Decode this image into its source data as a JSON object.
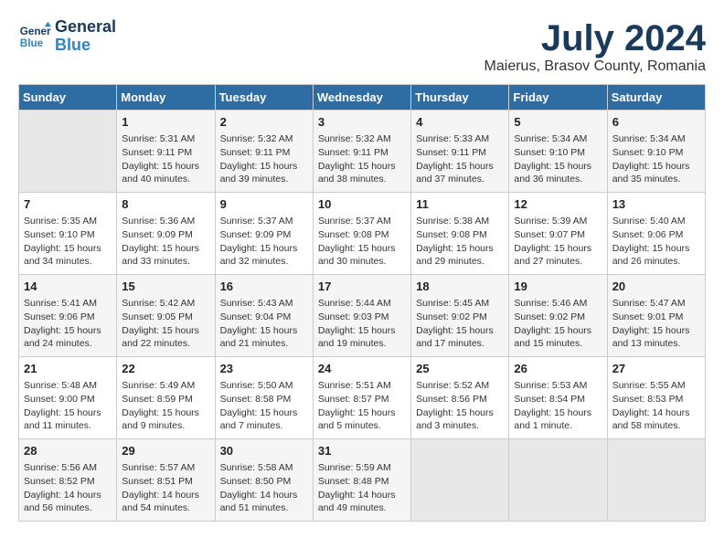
{
  "header": {
    "logo_line1": "General",
    "logo_line2": "Blue",
    "month": "July 2024",
    "location": "Maierus, Brasov County, Romania"
  },
  "days_of_week": [
    "Sunday",
    "Monday",
    "Tuesday",
    "Wednesday",
    "Thursday",
    "Friday",
    "Saturday"
  ],
  "weeks": [
    [
      {
        "day": "",
        "content": ""
      },
      {
        "day": "1",
        "content": "Sunrise: 5:31 AM\nSunset: 9:11 PM\nDaylight: 15 hours\nand 40 minutes."
      },
      {
        "day": "2",
        "content": "Sunrise: 5:32 AM\nSunset: 9:11 PM\nDaylight: 15 hours\nand 39 minutes."
      },
      {
        "day": "3",
        "content": "Sunrise: 5:32 AM\nSunset: 9:11 PM\nDaylight: 15 hours\nand 38 minutes."
      },
      {
        "day": "4",
        "content": "Sunrise: 5:33 AM\nSunset: 9:11 PM\nDaylight: 15 hours\nand 37 minutes."
      },
      {
        "day": "5",
        "content": "Sunrise: 5:34 AM\nSunset: 9:10 PM\nDaylight: 15 hours\nand 36 minutes."
      },
      {
        "day": "6",
        "content": "Sunrise: 5:34 AM\nSunset: 9:10 PM\nDaylight: 15 hours\nand 35 minutes."
      }
    ],
    [
      {
        "day": "7",
        "content": "Sunrise: 5:35 AM\nSunset: 9:10 PM\nDaylight: 15 hours\nand 34 minutes."
      },
      {
        "day": "8",
        "content": "Sunrise: 5:36 AM\nSunset: 9:09 PM\nDaylight: 15 hours\nand 33 minutes."
      },
      {
        "day": "9",
        "content": "Sunrise: 5:37 AM\nSunset: 9:09 PM\nDaylight: 15 hours\nand 32 minutes."
      },
      {
        "day": "10",
        "content": "Sunrise: 5:37 AM\nSunset: 9:08 PM\nDaylight: 15 hours\nand 30 minutes."
      },
      {
        "day": "11",
        "content": "Sunrise: 5:38 AM\nSunset: 9:08 PM\nDaylight: 15 hours\nand 29 minutes."
      },
      {
        "day": "12",
        "content": "Sunrise: 5:39 AM\nSunset: 9:07 PM\nDaylight: 15 hours\nand 27 minutes."
      },
      {
        "day": "13",
        "content": "Sunrise: 5:40 AM\nSunset: 9:06 PM\nDaylight: 15 hours\nand 26 minutes."
      }
    ],
    [
      {
        "day": "14",
        "content": "Sunrise: 5:41 AM\nSunset: 9:06 PM\nDaylight: 15 hours\nand 24 minutes."
      },
      {
        "day": "15",
        "content": "Sunrise: 5:42 AM\nSunset: 9:05 PM\nDaylight: 15 hours\nand 22 minutes."
      },
      {
        "day": "16",
        "content": "Sunrise: 5:43 AM\nSunset: 9:04 PM\nDaylight: 15 hours\nand 21 minutes."
      },
      {
        "day": "17",
        "content": "Sunrise: 5:44 AM\nSunset: 9:03 PM\nDaylight: 15 hours\nand 19 minutes."
      },
      {
        "day": "18",
        "content": "Sunrise: 5:45 AM\nSunset: 9:02 PM\nDaylight: 15 hours\nand 17 minutes."
      },
      {
        "day": "19",
        "content": "Sunrise: 5:46 AM\nSunset: 9:02 PM\nDaylight: 15 hours\nand 15 minutes."
      },
      {
        "day": "20",
        "content": "Sunrise: 5:47 AM\nSunset: 9:01 PM\nDaylight: 15 hours\nand 13 minutes."
      }
    ],
    [
      {
        "day": "21",
        "content": "Sunrise: 5:48 AM\nSunset: 9:00 PM\nDaylight: 15 hours\nand 11 minutes."
      },
      {
        "day": "22",
        "content": "Sunrise: 5:49 AM\nSunset: 8:59 PM\nDaylight: 15 hours\nand 9 minutes."
      },
      {
        "day": "23",
        "content": "Sunrise: 5:50 AM\nSunset: 8:58 PM\nDaylight: 15 hours\nand 7 minutes."
      },
      {
        "day": "24",
        "content": "Sunrise: 5:51 AM\nSunset: 8:57 PM\nDaylight: 15 hours\nand 5 minutes."
      },
      {
        "day": "25",
        "content": "Sunrise: 5:52 AM\nSunset: 8:56 PM\nDaylight: 15 hours\nand 3 minutes."
      },
      {
        "day": "26",
        "content": "Sunrise: 5:53 AM\nSunset: 8:54 PM\nDaylight: 15 hours\nand 1 minute."
      },
      {
        "day": "27",
        "content": "Sunrise: 5:55 AM\nSunset: 8:53 PM\nDaylight: 14 hours\nand 58 minutes."
      }
    ],
    [
      {
        "day": "28",
        "content": "Sunrise: 5:56 AM\nSunset: 8:52 PM\nDaylight: 14 hours\nand 56 minutes."
      },
      {
        "day": "29",
        "content": "Sunrise: 5:57 AM\nSunset: 8:51 PM\nDaylight: 14 hours\nand 54 minutes."
      },
      {
        "day": "30",
        "content": "Sunrise: 5:58 AM\nSunset: 8:50 PM\nDaylight: 14 hours\nand 51 minutes."
      },
      {
        "day": "31",
        "content": "Sunrise: 5:59 AM\nSunset: 8:48 PM\nDaylight: 14 hours\nand 49 minutes."
      },
      {
        "day": "",
        "content": ""
      },
      {
        "day": "",
        "content": ""
      },
      {
        "day": "",
        "content": ""
      }
    ]
  ]
}
